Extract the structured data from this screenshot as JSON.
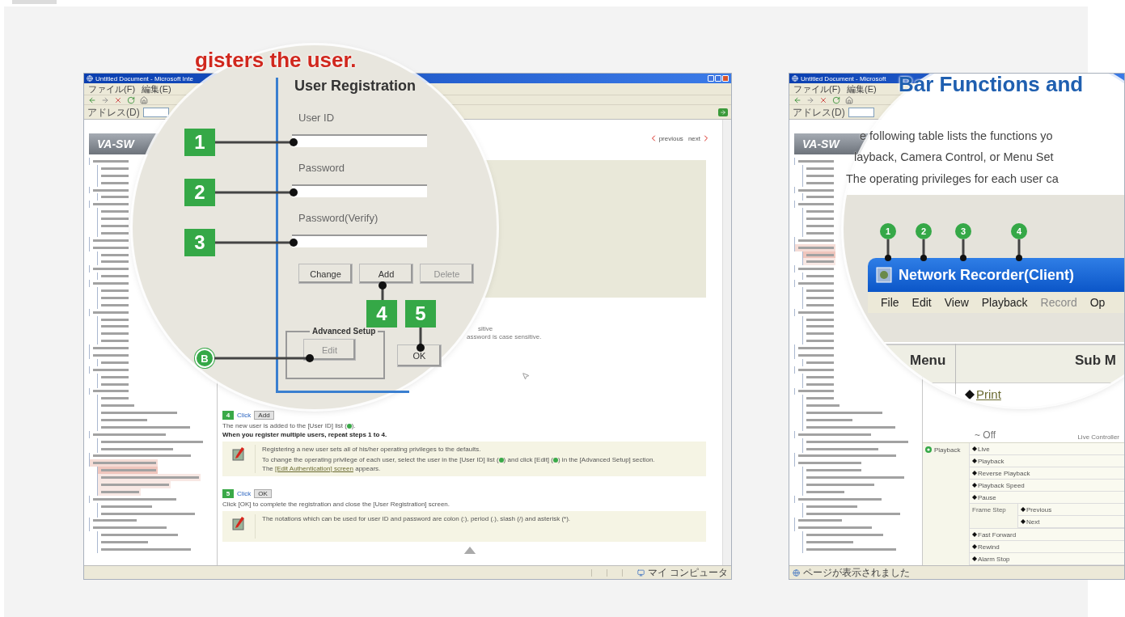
{
  "screens": [
    {
      "kind": "registration",
      "window_title": "Untitled Document - Microsoft Inte",
      "menu": [
        "ファイル(F)",
        "編集(E)"
      ],
      "address_label": "アドレス(D)",
      "logo": "VA-SW",
      "sidebar": [
        {
          "selected": false,
          "children": [
            {
              "selected": false
            },
            {
              "selected": false
            },
            {
              "selected": false
            }
          ]
        },
        {
          "selected": false,
          "children": [
            {
              "selected": false
            }
          ]
        },
        {
          "selected": false,
          "children": [
            {
              "selected": false
            },
            {
              "selected": false
            },
            {
              "selected": false
            },
            {
              "selected": false
            }
          ]
        },
        {
          "selected": false
        },
        {
          "selected": false,
          "children": [
            {
              "selected": false
            },
            {
              "selected": false
            }
          ]
        },
        {
          "selected": false,
          "children": [
            {
              "selected": false
            }
          ]
        },
        {
          "selected": false,
          "children": [
            {
              "selected": false
            },
            {
              "selected": false
            },
            {
              "selected": false
            }
          ]
        },
        {
          "selected": false,
          "children": [
            {
              "selected": false
            },
            {
              "selected": false
            },
            {
              "selected": false
            },
            {
              "selected": false
            }
          ]
        },
        {
          "selected": false
        },
        {
          "selected": false,
          "children": [
            {
              "selected": false
            }
          ]
        },
        {
          "selected": false,
          "children": [
            {
              "selected": false
            },
            {
              "selected": false
            }
          ]
        },
        {
          "selected": false,
          "children": [
            {
              "selected": false
            },
            {
              "selected": false
            },
            {
              "selected": false
            },
            {
              "selected": false
            },
            {
              "selected": false
            }
          ]
        },
        {
          "selected": false,
          "children": [
            {
              "selected": false
            },
            {
              "selected": false
            }
          ]
        },
        {
          "selected": false
        },
        {
          "selected": true,
          "children": [
            {
              "selected": true
            },
            {
              "selected": false
            },
            {
              "selected": false
            },
            {
              "selected": false
            }
          ]
        },
        {
          "selected": false,
          "children": [
            {
              "selected": false
            },
            {
              "selected": false
            }
          ]
        },
        {
          "selected": false
        },
        {
          "selected": false,
          "children": [
            {
              "selected": false
            },
            {
              "selected": false
            },
            {
              "selected": false
            }
          ]
        }
      ],
      "nav": {
        "previous": "previous",
        "next": "next"
      },
      "fragments": [
        "sitive",
        "assword is case sensitive."
      ],
      "magnifier": {
        "headline": "gisters the user.",
        "dialog_title": "User Registration",
        "fields": [
          "User ID",
          "Password",
          "Password(Verify)"
        ],
        "callouts": [
          "1",
          "2",
          "3",
          "4",
          "5"
        ],
        "buttons": [
          {
            "label": "Change",
            "disabled": false
          },
          {
            "label": "Add",
            "disabled": false
          },
          {
            "label": "Delete",
            "disabled": true
          }
        ],
        "advanced_legend": "Advanced Setup",
        "edit_button": {
          "label": "Edit",
          "disabled": true
        },
        "marker": "B",
        "ok_button": {
          "label": "OK",
          "disabled": false
        }
      },
      "steps": [
        {
          "number": "4",
          "action": "Click",
          "button": "Add",
          "lines": [
            {
              "kind": "plain",
              "segments": [
                {
                  "kind": "text",
                  "text": "The new user is added to the [User ID] list ("
                },
                {
                  "kind": "marker"
                },
                {
                  "kind": "text",
                  "text": ")."
                }
              ]
            },
            {
              "kind": "bold",
              "segments": [
                {
                  "kind": "text",
                  "text": "When you register multiple users, repeat steps 1 to 4."
                }
              ]
            }
          ],
          "notes": [
            {
              "segments": [
                {
                  "kind": "text",
                  "text": "Registering a new user sets all of his/her operating privileges to the defaults."
                }
              ]
            },
            {
              "segments": [
                {
                  "kind": "text",
                  "text": "To change the operating privilege of each user, select the user in the [User ID] list ("
                },
                {
                  "kind": "marker"
                },
                {
                  "kind": "text",
                  "text": ") and click [Edit] ("
                },
                {
                  "kind": "marker"
                },
                {
                  "kind": "text",
                  "text": ") in the [Advanced Setup] section."
                },
                {
                  "kind": "break"
                },
                {
                  "kind": "text",
                  "text": "The "
                },
                {
                  "kind": "link",
                  "text": "[Edit Authentication] screen"
                },
                {
                  "kind": "text",
                  "text": " appears."
                }
              ]
            }
          ]
        },
        {
          "number": "5",
          "action": "Click",
          "button": "OK",
          "lines": [
            {
              "kind": "plain",
              "segments": [
                {
                  "kind": "text",
                  "text": "Click [OK] to complete the registration and close the [User Registration] screen."
                }
              ]
            }
          ],
          "notes": [
            {
              "segments": [
                {
                  "kind": "text",
                  "text": "The notations which can be used for user ID and password are colon (:), period (.), slash (/) and asterisk (*)."
                }
              ]
            }
          ]
        }
      ],
      "status": "マイ コンピュータ"
    },
    {
      "kind": "menu_bar",
      "window_title": "Untitled Document - Microsoft",
      "menu": [
        "ファイル(F)",
        "編集(E)"
      ],
      "address_label": "アドレス(D)",
      "logo": "VA-SW",
      "sidebar": [
        {
          "selected": false,
          "children": [
            {
              "selected": false
            },
            {
              "selected": false
            },
            {
              "selected": false
            }
          ]
        },
        {
          "selected": false,
          "children": [
            {
              "selected": false
            }
          ]
        },
        {
          "selected": false,
          "children": [
            {
              "selected": false
            },
            {
              "selected": false
            },
            {
              "selected": false
            },
            {
              "selected": false
            }
          ]
        },
        {
          "selected": false
        },
        {
          "selected": true,
          "children": [
            {
              "selected": true
            },
            {
              "selected": false
            }
          ]
        },
        {
          "selected": false,
          "children": [
            {
              "selected": false
            }
          ]
        },
        {
          "selected": false,
          "children": [
            {
              "selected": false
            },
            {
              "selected": false
            },
            {
              "selected": false
            }
          ]
        },
        {
          "selected": false,
          "children": [
            {
              "selected": false
            },
            {
              "selected": false
            },
            {
              "selected": false
            },
            {
              "selected": false
            }
          ]
        },
        {
          "selected": false
        },
        {
          "selected": false,
          "children": [
            {
              "selected": false
            }
          ]
        },
        {
          "selected": false,
          "children": [
            {
              "selected": false
            },
            {
              "selected": false
            }
          ]
        },
        {
          "selected": false,
          "children": [
            {
              "selected": false
            },
            {
              "selected": false
            },
            {
              "selected": false
            },
            {
              "selected": false
            },
            {
              "selected": false
            }
          ]
        },
        {
          "selected": false,
          "children": [
            {
              "selected": false
            },
            {
              "selected": false
            }
          ]
        },
        {
          "selected": false
        },
        {
          "selected": false,
          "children": [
            {
              "selected": false
            },
            {
              "selected": false
            },
            {
              "selected": false
            },
            {
              "selected": false
            }
          ]
        },
        {
          "selected": false,
          "children": [
            {
              "selected": false
            },
            {
              "selected": false
            }
          ]
        },
        {
          "selected": false
        },
        {
          "selected": false,
          "children": [
            {
              "selected": false
            },
            {
              "selected": false
            },
            {
              "selected": false
            }
          ]
        }
      ],
      "magnifier": {
        "heading": "Bar Functions and",
        "paragraph": [
          "e following table lists the functions yo",
          "layback, Camera Control, or Menu Set",
          "The operating privileges for each user ca"
        ],
        "callouts": [
          "1",
          "2",
          "3",
          "4"
        ],
        "app_title": "Network Recorder(Client)",
        "app_menu": [
          {
            "label": "File",
            "disabled": false
          },
          {
            "label": "Edit",
            "disabled": false
          },
          {
            "label": "View",
            "disabled": false
          },
          {
            "label": "Playback",
            "disabled": false
          },
          {
            "label": "Record",
            "disabled": true
          },
          {
            "label": "Op",
            "disabled": false
          }
        ],
        "table_headers": [
          "Menu",
          "Sub M"
        ],
        "first_item": "Print"
      },
      "off": "~ Off",
      "live_controller": "Live Controller",
      "group": "Playback",
      "items": [
        {
          "label": "Live"
        },
        {
          "label": "Playback"
        },
        {
          "label": "Reverse Playback"
        },
        {
          "label": "Playback Speed"
        },
        {
          "label": "Pause"
        },
        {
          "label": "Frame Step",
          "children": [
            {
              "label": "Previous"
            },
            {
              "label": "Next"
            }
          ]
        },
        {
          "label": "Fast Forward"
        },
        {
          "label": "Rewind"
        },
        {
          "label": "Alarm Stop"
        }
      ],
      "status": "ページが表示されました"
    }
  ]
}
